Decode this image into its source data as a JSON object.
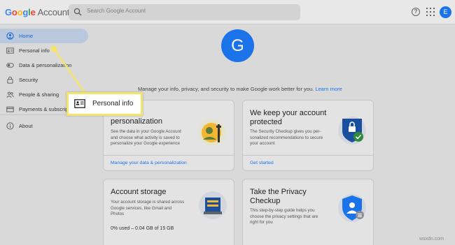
{
  "header": {
    "logo_word": "Google",
    "logo_suffix": "Account",
    "search_placeholder": "Search Google Account",
    "avatar_letter": "E"
  },
  "sidebar": {
    "items": [
      {
        "label": "Home"
      },
      {
        "label": "Personal info"
      },
      {
        "label": "Data & personalization"
      },
      {
        "label": "Security"
      },
      {
        "label": "People & sharing"
      },
      {
        "label": "Payments & subscriptions"
      },
      {
        "label": "About"
      }
    ]
  },
  "main": {
    "avatar_letter": "G",
    "intro_text": "Manage your info, privacy, and security to make Google work better for you.",
    "intro_link": "Learn more"
  },
  "cards": {
    "personalization": {
      "title": "personalization",
      "desc_lines": [
        "See the data in your Google Account",
        "and choose what activity is saved to",
        "personalize your Google experience"
      ],
      "link": "Manage your data & personalization"
    },
    "security": {
      "title_lines": [
        "We keep your account",
        "protected"
      ],
      "desc_lines": [
        "The Security Checkup gives you per-",
        "sonalized recommendations to secure",
        "your account"
      ],
      "link": "Get started"
    },
    "storage": {
      "title": "Account storage",
      "desc_lines": [
        "Your account storage is shared across",
        "Google services, like Gmail and",
        "Photos"
      ],
      "usage": "0% used – 0.04 GB of 15 GB"
    },
    "privacy": {
      "title_lines": [
        "Take the Privacy",
        "Checkup"
      ],
      "desc_lines": [
        "This step-by-step guide helps you",
        "choose the privacy settings that are",
        "right for you"
      ]
    }
  },
  "callout": {
    "label": "Personal info"
  },
  "watermark": "wsxdn.com",
  "colors": {
    "accent": "#1a73e8",
    "callout_border": "#f5e46b"
  }
}
